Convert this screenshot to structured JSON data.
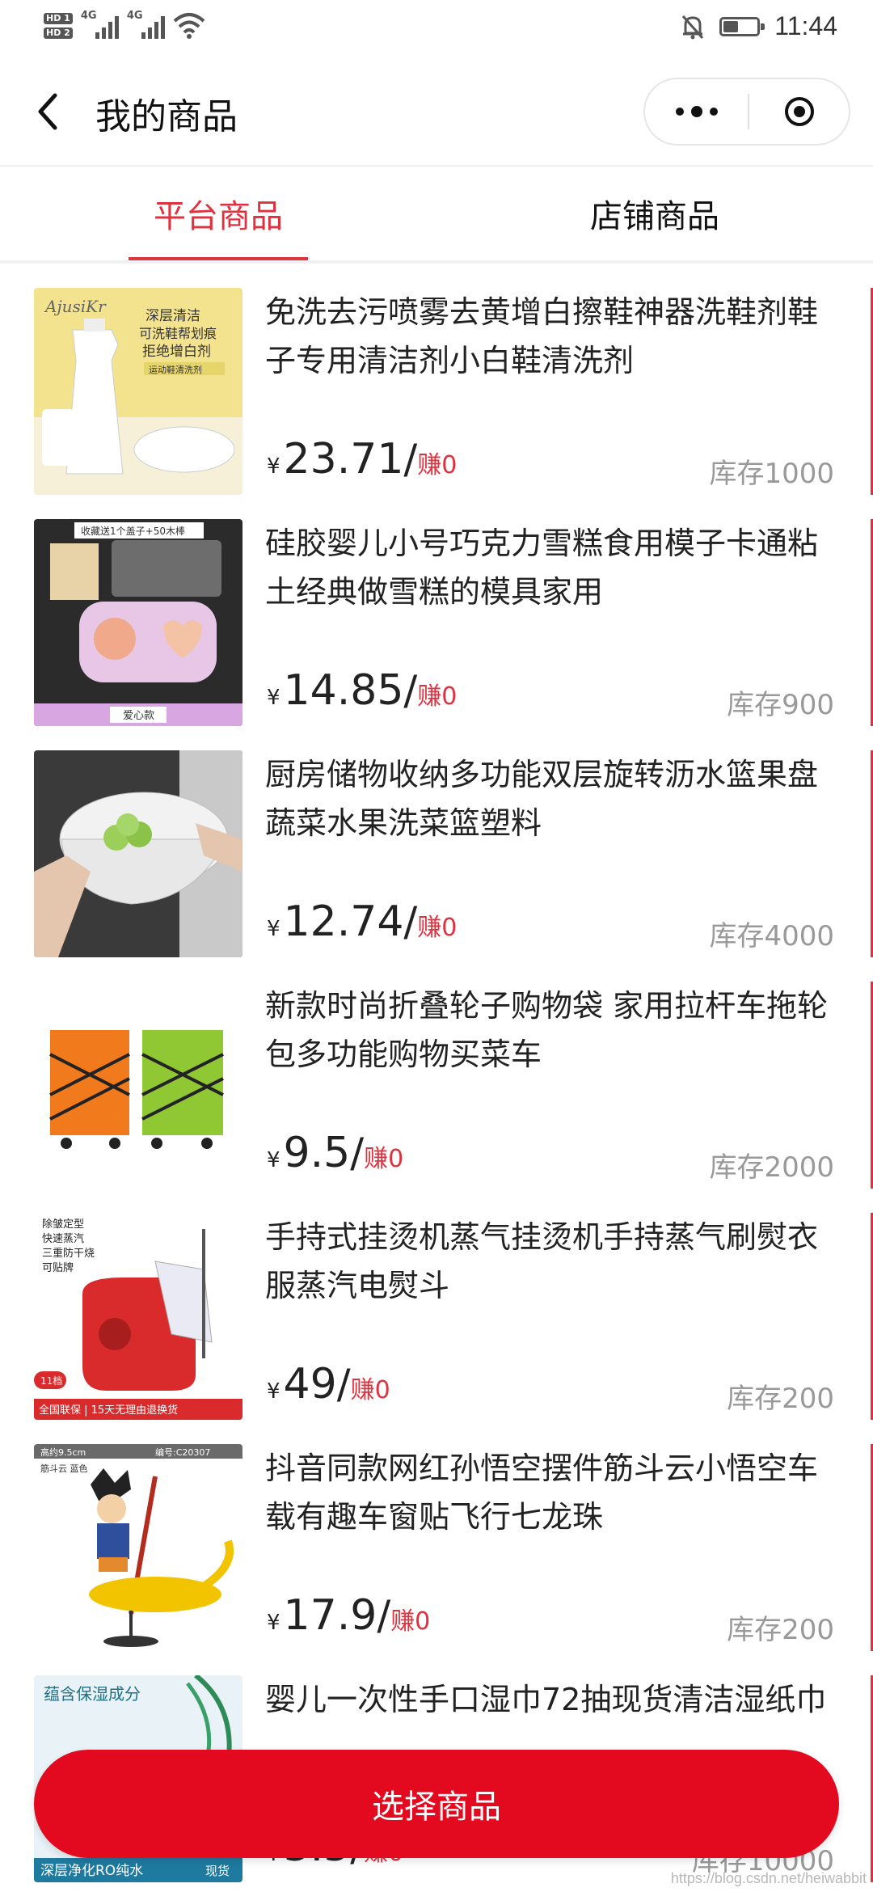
{
  "status_bar": {
    "hd1": "HD 1",
    "hd2": "HD 2",
    "net1": "4G",
    "net2": "4G",
    "time": "11:44",
    "battery_level": 0.45,
    "icons": [
      "signal-icon",
      "wifi-icon",
      "mute-bell-icon",
      "battery-icon"
    ]
  },
  "nav": {
    "title": "我的商品",
    "icons": [
      "back-arrow-icon",
      "more-dots-icon",
      "close-circle-icon"
    ]
  },
  "tabs": [
    {
      "label": "平台商品",
      "active": true
    },
    {
      "label": "店铺商品",
      "active": false
    }
  ],
  "accent_color": "#e0313f",
  "products": [
    {
      "name": "免洗去污喷雾去黄增白擦鞋神器洗鞋剂鞋子专用清洁剂小白鞋清洗剂",
      "currency": "¥",
      "price": "23.71",
      "slash": "/",
      "earn": "赚0",
      "stock": "库存1000",
      "thumb_text": [
        "AjusiKr",
        "深层清洁",
        "可洗鞋帮划痕",
        "拒绝增白剂",
        "运动鞋清洗剂"
      ]
    },
    {
      "name": "硅胶婴儿小号巧克力雪糕食用模子卡通粘土经典做雪糕的模具家用",
      "currency": "¥",
      "price": "14.85",
      "slash": "/",
      "earn": "赚0",
      "stock": "库存900",
      "thumb_text": [
        "收藏送1个盖子+50木棒",
        "爱心款"
      ]
    },
    {
      "name": "厨房储物收纳多功能双层旋转沥水篮果盘蔬菜水果洗菜篮塑料",
      "currency": "¥",
      "price": "12.74",
      "slash": "/",
      "earn": "赚0",
      "stock": "库存4000",
      "thumb_text": []
    },
    {
      "name": "新款时尚折叠轮子购物袋 家用拉杆车拖轮包多功能购物买菜车",
      "currency": "¥",
      "price": "9.5",
      "slash": "/",
      "earn": "赚0",
      "stock": "库存2000",
      "thumb_text": []
    },
    {
      "name": "手持式挂烫机蒸气挂烫机手持蒸气刷熨衣服蒸汽电熨斗",
      "currency": "¥",
      "price": "49",
      "slash": "/",
      "earn": "赚0",
      "stock": "库存200",
      "thumb_text": [
        "除皱定型",
        "快速蒸汽",
        "三重防干烧",
        "可贴牌",
        "11档",
        "全国联保 | 15天无理由退换货"
      ]
    },
    {
      "name": "抖音同款网红孙悟空摆件筋斗云小悟空车载有趣车窗贴飞行七龙珠",
      "currency": "¥",
      "price": "17.9",
      "slash": "/",
      "earn": "赚0",
      "stock": "库存200",
      "thumb_text": [
        "高约9.5cm",
        "编号:C20307",
        "筋斗云 蓝色"
      ]
    },
    {
      "name": "婴儿一次性手口湿巾72抽现货清洁湿纸巾",
      "currency": "¥",
      "price": "3.5",
      "slash": "/",
      "earn": "赚0",
      "stock": "库存10000",
      "thumb_text": [
        "蕴含保湿成分",
        "深层净化RO纯水",
        "现货"
      ]
    }
  ],
  "bottom": {
    "button_label": "选择商品"
  },
  "watermark": "https://blog.csdn.net/heiwabbit"
}
